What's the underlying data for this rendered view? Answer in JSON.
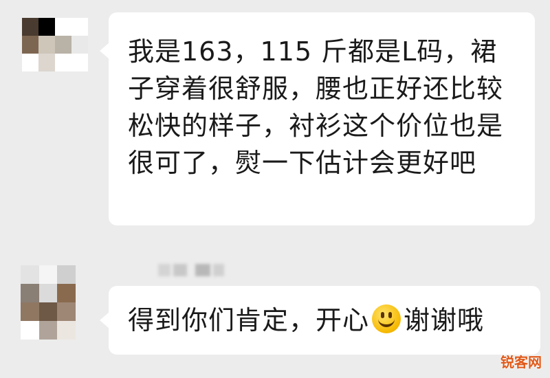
{
  "messages": [
    {
      "text": "我是163，115 斤都是L码，裙子穿着很舒服，腰也正好还比较松快的样子，衬衫这个价位也是很可了，熨一下估计会更好吧"
    },
    {
      "text_before_emoji": "得到你们肯定，开心",
      "emoji": "smiling-face-icon",
      "text_after_emoji": "谢谢哦"
    }
  ],
  "avatars": [
    {
      "colors": [
        "#4a3b30",
        "#000000",
        "#ffffff",
        "#ffffff",
        "#7d6651",
        "#cfc6ba",
        "#b9b2a7",
        "#e9e9e9",
        "#ffffff",
        "#dcd6cf",
        "#ffffff",
        "#ffffff"
      ]
    },
    {
      "colors": [
        "#e3e3e3",
        "#f5f5f5",
        "#cfcfcf",
        "#8a7f75",
        "#dbdbdb",
        "#8a6a4e",
        "#8f7762",
        "#6e5846",
        "#9e8775",
        "#ffffff",
        "#b0a49a",
        "#ece6e1"
      ]
    }
  ],
  "watermark": "锐客网"
}
